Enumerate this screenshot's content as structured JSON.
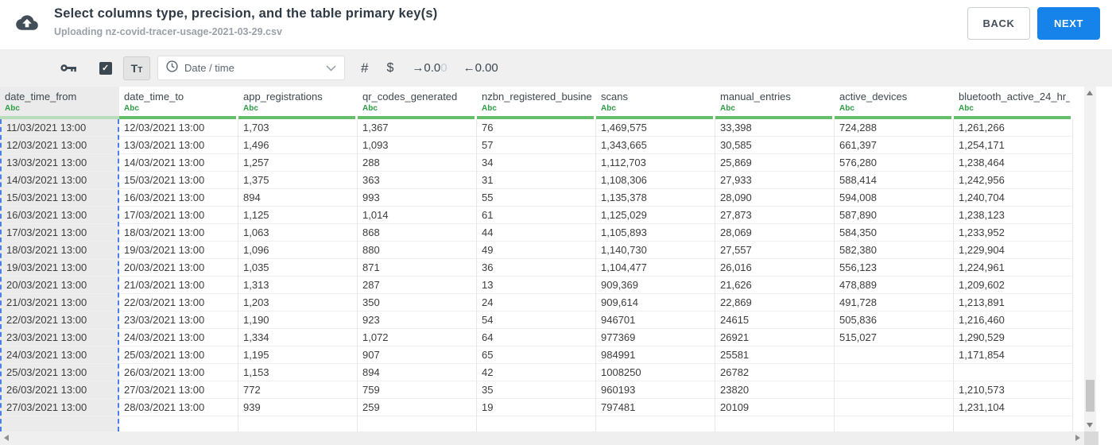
{
  "header": {
    "title": "Select columns type, precision, and the table primary key(s)",
    "subtitle": "Uploading nz-covid-tracer-usage-2021-03-29.csv",
    "back_label": "BACK",
    "next_label": "NEXT"
  },
  "toolbar": {
    "icons": {
      "primary_key": "key-icon",
      "checkbox": "checkbox-checked",
      "text_type": "text-type-button",
      "type_select": "clock-icon",
      "dropdown": "chevron-down-icon"
    },
    "text_button_label": "Tt",
    "type_select": {
      "value": "Date / time"
    },
    "number_symbol": "#",
    "currency_symbol": "$",
    "decimal_expand": {
      "label": "→0.0",
      "faded": "0"
    },
    "decimal_shrink": {
      "label": "←0.00"
    }
  },
  "table": {
    "columns": [
      {
        "name": "date_time_from",
        "type_label": "Abc",
        "selected": true
      },
      {
        "name": "date_time_to",
        "type_label": "Abc",
        "selected": false
      },
      {
        "name": "app_registrations",
        "type_label": "Abc",
        "selected": false
      },
      {
        "name": "qr_codes_generated",
        "type_label": "Abc",
        "selected": false
      },
      {
        "name": "nzbn_registered_busine",
        "type_label": "Abc",
        "selected": false
      },
      {
        "name": "scans",
        "type_label": "Abc",
        "selected": false
      },
      {
        "name": "manual_entries",
        "type_label": "Abc",
        "selected": false
      },
      {
        "name": "active_devices",
        "type_label": "Abc",
        "selected": false
      },
      {
        "name": "bluetooth_active_24_hr_",
        "type_label": "Abc",
        "selected": false
      }
    ],
    "rows": [
      [
        "11/03/2021 13:00",
        "12/03/2021 13:00",
        "1,703",
        "1,367",
        "76",
        "1,469,575",
        "33,398",
        "724,288",
        "1,261,266"
      ],
      [
        "12/03/2021 13:00",
        "13/03/2021 13:00",
        "1,496",
        "1,093",
        "57",
        "1,343,665",
        "30,585",
        "661,397",
        "1,254,171"
      ],
      [
        "13/03/2021 13:00",
        "14/03/2021 13:00",
        "1,257",
        "288",
        "34",
        "1,112,703",
        "25,869",
        "576,280",
        "1,238,464"
      ],
      [
        "14/03/2021 13:00",
        "15/03/2021 13:00",
        "1,375",
        "363",
        "31",
        "1,108,306",
        "27,933",
        "588,414",
        "1,242,956"
      ],
      [
        "15/03/2021 13:00",
        "16/03/2021 13:00",
        "894",
        "993",
        "55",
        "1,135,378",
        "28,090",
        "594,008",
        "1,240,704"
      ],
      [
        "16/03/2021 13:00",
        "17/03/2021 13:00",
        "1,125",
        "1,014",
        "61",
        "1,125,029",
        "27,873",
        "587,890",
        "1,238,123"
      ],
      [
        "17/03/2021 13:00",
        "18/03/2021 13:00",
        "1,063",
        "868",
        "44",
        "1,105,893",
        "28,069",
        "584,350",
        "1,233,952"
      ],
      [
        "18/03/2021 13:00",
        "19/03/2021 13:00",
        "1,096",
        "880",
        "49",
        "1,140,730",
        "27,557",
        "582,380",
        "1,229,904"
      ],
      [
        "19/03/2021 13:00",
        "20/03/2021 13:00",
        "1,035",
        "871",
        "36",
        "1,104,477",
        "26,016",
        "556,123",
        "1,224,961"
      ],
      [
        "20/03/2021 13:00",
        "21/03/2021 13:00",
        "1,313",
        "287",
        "13",
        "909,369",
        "21,626",
        "478,889",
        "1,209,602"
      ],
      [
        "21/03/2021 13:00",
        "22/03/2021 13:00",
        "1,203",
        "350",
        "24",
        "909,614",
        "22,869",
        "491,728",
        "1,213,891"
      ],
      [
        "22/03/2021 13:00",
        "23/03/2021 13:00",
        "1,190",
        "923",
        "54",
        "946701",
        "24615",
        "505,836",
        "1,216,460"
      ],
      [
        "23/03/2021 13:00",
        "24/03/2021 13:00",
        "1,334",
        "1,072",
        "64",
        "977369",
        "26921",
        "515,027",
        "1,290,529"
      ],
      [
        "24/03/2021 13:00",
        "25/03/2021 13:00",
        "1,195",
        "907",
        "65",
        "984991",
        "25581",
        "",
        "1,171,854"
      ],
      [
        "25/03/2021 13:00",
        "26/03/2021 13:00",
        "1,153",
        "894",
        "42",
        "1008250",
        "26782",
        "",
        ""
      ],
      [
        "26/03/2021 13:00",
        "27/03/2021 13:00",
        "772",
        "759",
        "35",
        "960193",
        "23820",
        "",
        "1,210,573"
      ],
      [
        "27/03/2021 13:00",
        "28/03/2021 13:00",
        "939",
        "259",
        "19",
        "797481",
        "20109",
        "",
        "1,231,104"
      ]
    ]
  },
  "colors": {
    "accent_blue": "#1583e9",
    "selection_dash_blue": "#4a7fe8",
    "type_green": "#2f9e44",
    "column_bar_green": "#65bf6a",
    "column_bar_green_selected": "#b9dcba",
    "toolbar_bg": "#f0f0f1",
    "selected_column_bg": "#ebebeb"
  }
}
